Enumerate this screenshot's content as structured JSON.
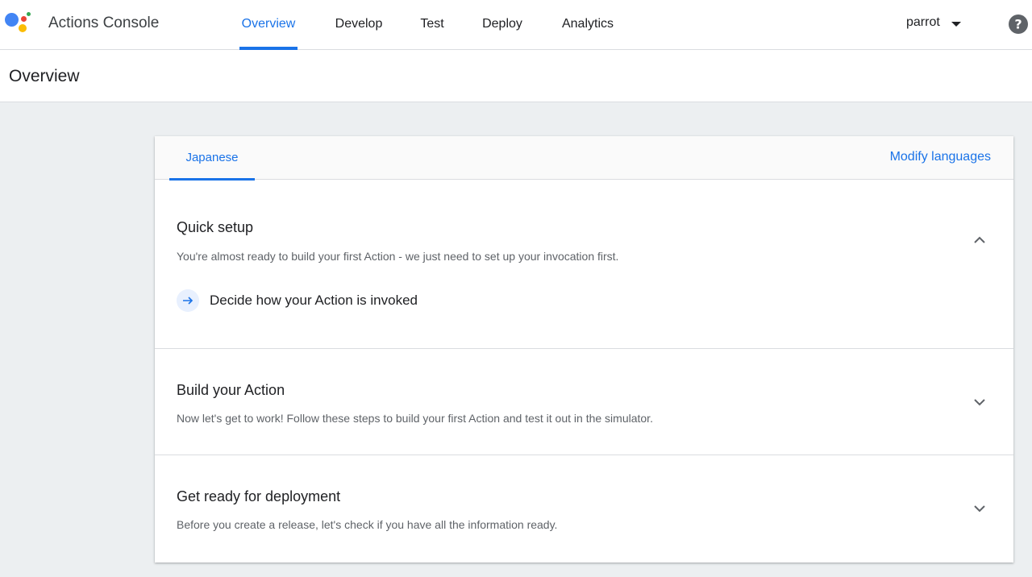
{
  "header": {
    "app_title": "Actions Console",
    "nav": [
      {
        "label": "Overview",
        "active": true
      },
      {
        "label": "Develop"
      },
      {
        "label": "Test"
      },
      {
        "label": "Deploy"
      },
      {
        "label": "Analytics"
      }
    ],
    "project": "parrot",
    "icons": {
      "logo": "google-assistant-logo",
      "dropdown": "caret-down-icon",
      "help": "help-circle-icon"
    }
  },
  "page": {
    "title": "Overview"
  },
  "card": {
    "language_tab": "Japanese",
    "modify_languages": "Modify languages",
    "sections": [
      {
        "title": "Quick setup",
        "description": "You're almost ready to build your first Action - we just need to set up your invocation first.",
        "expanded": true,
        "steps": [
          {
            "label": "Decide how your Action is invoked",
            "icon": "arrow-right-icon"
          }
        ]
      },
      {
        "title": "Build your Action",
        "description": "Now let's get to work! Follow these steps to build your first Action and test it out in the simulator.",
        "expanded": false
      },
      {
        "title": "Get ready for deployment",
        "description": "Before you create a release, let's check if you have all the information ready.",
        "expanded": false
      }
    ]
  },
  "colors": {
    "accent": "#1a73e8",
    "background": "#eceff1",
    "logo_blue": "#4285f4",
    "logo_red": "#ea4335",
    "logo_yellow": "#fbbc04",
    "logo_green": "#34a853"
  }
}
